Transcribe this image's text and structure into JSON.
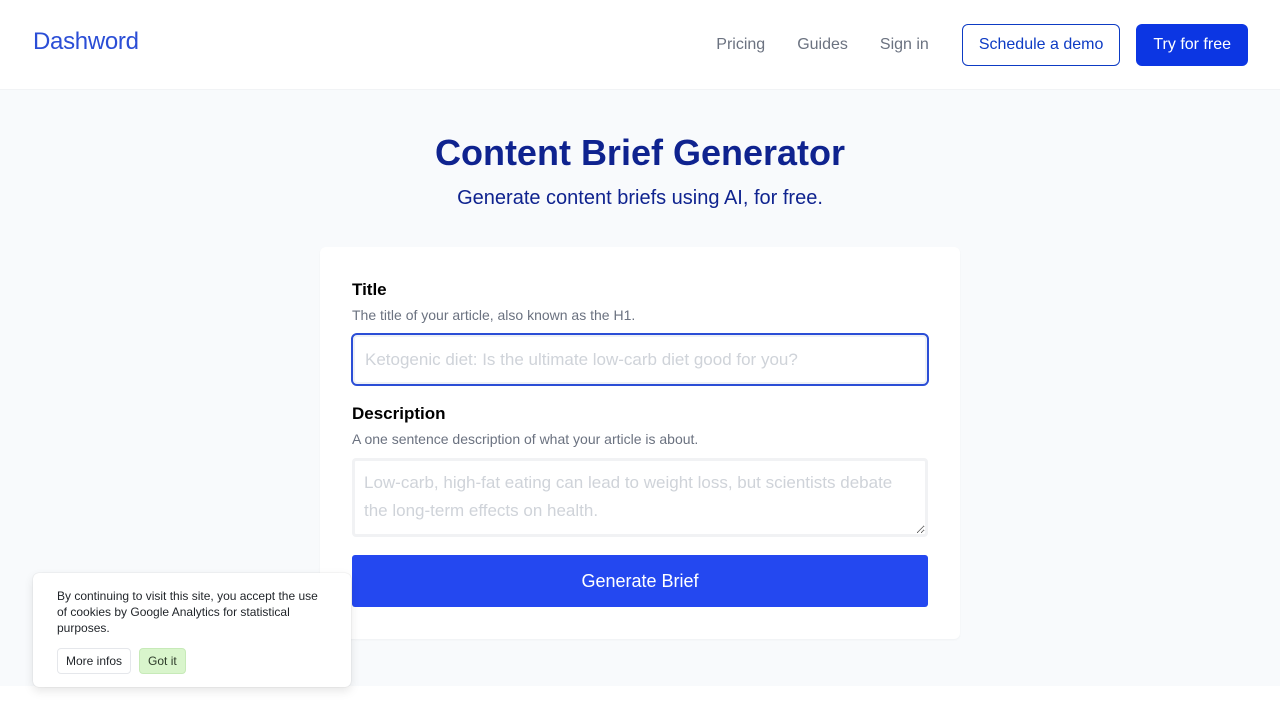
{
  "header": {
    "logo": "Dashword",
    "nav": [
      {
        "label": "Pricing"
      },
      {
        "label": "Guides"
      },
      {
        "label": "Sign in"
      }
    ],
    "schedule_demo_label": "Schedule a demo",
    "try_free_label": "Try for free"
  },
  "hero": {
    "title": "Content Brief Generator",
    "subtitle": "Generate content briefs using AI, for free."
  },
  "form": {
    "title_field": {
      "label": "Title",
      "help": "The title of your article, also known as the H1.",
      "value": "",
      "placeholder": "Ketogenic diet: Is the ultimate low-carb diet good for you?"
    },
    "description_field": {
      "label": "Description",
      "help": "A one sentence description of what your article is about.",
      "value": "",
      "placeholder": "Low-carb, high-fat eating can lead to weight loss, but scientists debate the long-term effects on health."
    },
    "submit_label": "Generate Brief"
  },
  "cookie_banner": {
    "text": "By continuing to visit this site, you accept the use of cookies by Google Analytics for statistical purposes.",
    "more_label": "More infos",
    "accept_label": "Got it"
  },
  "colors": {
    "brand": "#2b4ed6",
    "primary_button": "#0c36e3",
    "heading": "#0f238f",
    "generate_button": "#2448f0",
    "cookie_accept": "#d9f5cc"
  }
}
